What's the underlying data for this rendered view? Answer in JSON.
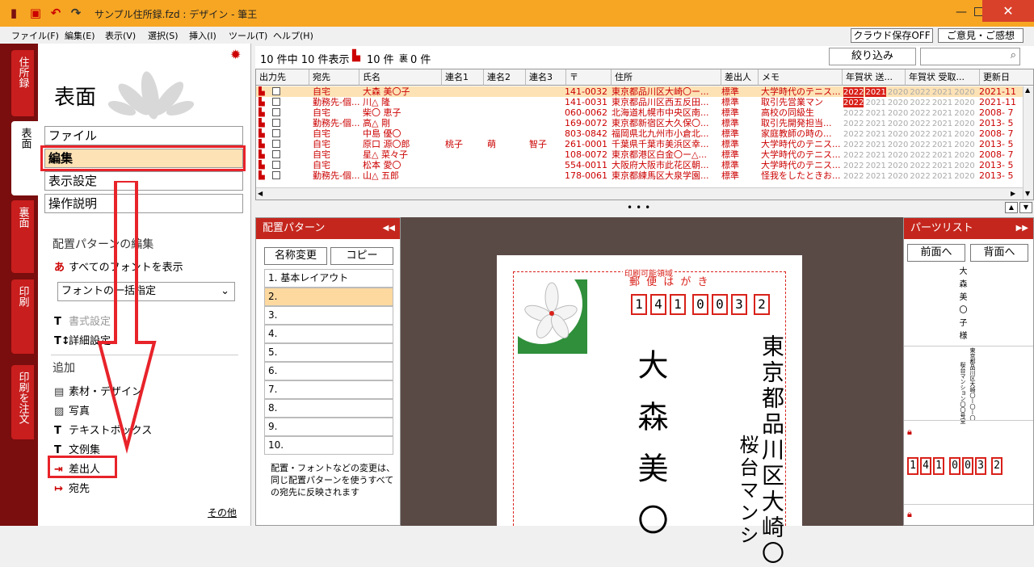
{
  "window": {
    "title": "サンプル住所録.fzd : デザイン - 筆王"
  },
  "menu": [
    "ファイル(F)",
    "編集(E)",
    "表示(V)",
    "選択(S)",
    "挿入(I)",
    "ツール(T)",
    "ヘルプ(H)"
  ],
  "top_buttons": {
    "cloud": "クラウド保存OFF",
    "feedback": "ご意見・ご感想"
  },
  "left_tabs": [
    "住所録",
    "表面",
    "裏面",
    "印刷",
    "印刷を注文"
  ],
  "left_panel": {
    "heading": "表面",
    "menus": [
      "ファイル",
      "編集",
      "表示設定",
      "操作説明"
    ],
    "layout_section": "配置パターンの編集",
    "show_all_fonts": "すべてのフォントを表示",
    "font_select": "フォントの一括指定",
    "style_settings": "書式設定",
    "detail_settings": "詳細設定",
    "add_section": "追加",
    "add_items": [
      "素材・デザイン",
      "写真",
      "テキストボックス",
      "文例集",
      "差出人",
      "宛先"
    ],
    "more": "その他"
  },
  "list": {
    "count_text": "10 件中 10 件表示",
    "front_count": "10 件",
    "back_label": "裏",
    "back_count": "0 件",
    "filter_button": "絞り込み",
    "search_placeholder": "",
    "columns": [
      "出力先",
      "宛先",
      "氏名",
      "連名1",
      "連名2",
      "連名3",
      "〒",
      "住所",
      "差出人",
      "メモ",
      "年賀状 送...",
      "年賀状 受取...",
      "更新日"
    ],
    "rows": [
      {
        "dest": "自宅",
        "name": "大森 美〇子",
        "r1": "",
        "r2": "",
        "r3": "",
        "zip": "141-0032",
        "addr": "東京都品川区大崎〇ー...",
        "sender": "標準",
        "memo": "大学時代のテニス...",
        "date": "2021-11"
      },
      {
        "dest": "勤務先-個...",
        "name": "川△ 隆",
        "r1": "",
        "r2": "",
        "r3": "",
        "zip": "141-0031",
        "addr": "東京都品川区西五反田...",
        "sender": "標準",
        "memo": "取引先営業マン",
        "date": "2021-11"
      },
      {
        "dest": "自宅",
        "name": "柴〇 恵子",
        "r1": "",
        "r2": "",
        "r3": "",
        "zip": "060-0062",
        "addr": "北海道札幌市中央区南...",
        "sender": "標準",
        "memo": "高校の同級生",
        "date": "2008- 7"
      },
      {
        "dest": "勤務先-個...",
        "name": "高△ 剛",
        "r1": "",
        "r2": "",
        "r3": "",
        "zip": "169-0072",
        "addr": "東京都新宿区大久保〇...",
        "sender": "標準",
        "memo": "取引先開発担当...",
        "date": "2013- 5"
      },
      {
        "dest": "自宅",
        "name": "中島 優〇",
        "r1": "",
        "r2": "",
        "r3": "",
        "zip": "803-0842",
        "addr": "福岡県北九州市小倉北...",
        "sender": "標準",
        "memo": "家庭教師の時の...",
        "date": "2008- 7"
      },
      {
        "dest": "自宅",
        "name": "原口 源〇郎",
        "r1": "桃子",
        "r2": "萌",
        "r3": "智子",
        "zip": "261-0001",
        "addr": "千葉県千葉市美浜区幸...",
        "sender": "標準",
        "memo": "大学時代のテニス...",
        "date": "2013- 5"
      },
      {
        "dest": "自宅",
        "name": "星△ 菜々子",
        "r1": "",
        "r2": "",
        "r3": "",
        "zip": "108-0072",
        "addr": "東京都港区白金〇ー△...",
        "sender": "標準",
        "memo": "大学時代のテニス...",
        "date": "2008- 7"
      },
      {
        "dest": "自宅",
        "name": "松本 愛〇",
        "r1": "",
        "r2": "",
        "r3": "",
        "zip": "554-0011",
        "addr": "大阪府大阪市此花区朝...",
        "sender": "標準",
        "memo": "大学時代のテニス...",
        "date": "2013- 5"
      },
      {
        "dest": "勤務先-個...",
        "name": "山△ 五郎",
        "r1": "",
        "r2": "",
        "r3": "",
        "zip": "178-0061",
        "addr": "東京都練馬区大泉学園...",
        "sender": "標準",
        "memo": "怪我をしたときお...",
        "date": "2013- 5"
      }
    ],
    "years": [
      "2022",
      "2021",
      "2020"
    ]
  },
  "pattern_panel": {
    "title": "配置パターン",
    "rename": "名称変更",
    "copy": "コピー",
    "patterns": [
      "1. 基本レイアウト",
      "2.",
      "3.",
      "4.",
      "5.",
      "6.",
      "7.",
      "8.",
      "9.",
      "10."
    ],
    "note": "配置・フォントなどの変更は、同じ配置パターンを使うすべての宛先に反映されます"
  },
  "card": {
    "printable": "印刷可能領域",
    "postcard": "郵 便 は が き",
    "zip_digits": [
      "1",
      "4",
      "1",
      "0",
      "0",
      "3",
      "2"
    ],
    "address": "東京都品川区大崎〇",
    "building": "桜台マンシ",
    "name": "大森美〇"
  },
  "parts_panel": {
    "title": "パーツリスト",
    "front": "前面へ",
    "back": "背面へ",
    "name_vertical": "大森美〇子様",
    "addr_vertical": "東京都品川区大崎〇ー〇ー〇",
    "addr_vertical2": "桜台マンション〇〇号室"
  },
  "colors": {
    "accent": "#c4261d",
    "title_bar": "#f6a623",
    "highlight": "#e8232a",
    "selected_row": "#fde2b5"
  }
}
